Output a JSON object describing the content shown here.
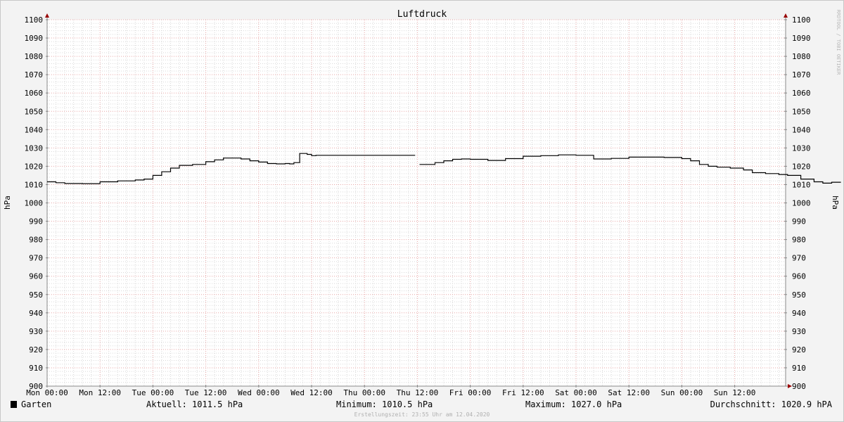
{
  "chart_data": {
    "type": "line",
    "title": "Luftdruck",
    "ylabel": "hPa",
    "ylim": [
      900,
      1100
    ],
    "y_ticks": [
      900,
      910,
      920,
      930,
      940,
      950,
      960,
      970,
      980,
      990,
      1000,
      1010,
      1020,
      1030,
      1040,
      1050,
      1060,
      1070,
      1080,
      1090,
      1100
    ],
    "x_tick_labels": [
      "Mon 00:00",
      "Mon 12:00",
      "Tue 00:00",
      "Tue 12:00",
      "Wed 00:00",
      "Wed 12:00",
      "Thu 00:00",
      "Thu 12:00",
      "Fri 00:00",
      "Fri 12:00",
      "Sat 00:00",
      "Sat 12:00",
      "Sun 00:00",
      "Sun 12:00"
    ],
    "x_unit": "hours since Mon 00:00",
    "xlim": [
      0,
      168
    ],
    "grid": true,
    "series": [
      {
        "name": "Garten",
        "color": "#000000",
        "segments": [
          [
            [
              0,
              1011.5
            ],
            [
              2,
              1011
            ],
            [
              4,
              1010.6
            ],
            [
              8,
              1010.5
            ],
            [
              12,
              1011.5
            ],
            [
              16,
              1012
            ],
            [
              20,
              1012.5
            ],
            [
              22,
              1013
            ],
            [
              24,
              1015
            ],
            [
              26,
              1017
            ],
            [
              28,
              1019
            ],
            [
              30,
              1020.5
            ],
            [
              33,
              1021
            ],
            [
              36,
              1022.5
            ],
            [
              38,
              1023.5
            ],
            [
              40,
              1024.5
            ],
            [
              42,
              1024.5
            ],
            [
              44,
              1024
            ],
            [
              46,
              1023
            ],
            [
              48,
              1022.3
            ],
            [
              50,
              1021.5
            ],
            [
              52,
              1021.3
            ],
            [
              54,
              1021.5
            ],
            [
              55,
              1021.3
            ],
            [
              56,
              1022
            ],
            [
              57,
              1022
            ],
            [
              57.3,
              1027
            ],
            [
              59,
              1026.5
            ],
            [
              60,
              1025.8
            ],
            [
              61,
              1026
            ],
            [
              64,
              1026
            ],
            [
              70,
              1026
            ],
            [
              76,
              1026
            ],
            [
              82,
              1026
            ],
            [
              83.5,
              1026
            ]
          ],
          [
            [
              84.5,
              1021
            ],
            [
              86,
              1021
            ],
            [
              88,
              1022
            ],
            [
              90,
              1023
            ],
            [
              92,
              1023.8
            ],
            [
              94,
              1024
            ],
            [
              96,
              1023.8
            ],
            [
              100,
              1023.2
            ],
            [
              104,
              1024.2
            ],
            [
              108,
              1025.5
            ],
            [
              112,
              1025.8
            ],
            [
              116,
              1026.2
            ],
            [
              120,
              1026
            ],
            [
              124,
              1024
            ],
            [
              128,
              1024.3
            ],
            [
              132,
              1025
            ],
            [
              136,
              1025
            ],
            [
              140,
              1024.8
            ],
            [
              144,
              1024.2
            ],
            [
              146,
              1023
            ],
            [
              148,
              1021
            ],
            [
              150,
              1020
            ],
            [
              152,
              1019.5
            ],
            [
              155,
              1019
            ],
            [
              158,
              1018
            ],
            [
              160,
              1016.5
            ],
            [
              163,
              1016
            ],
            [
              166,
              1015.5
            ],
            [
              168,
              1015
            ],
            [
              171,
              1013
            ],
            [
              174,
              1011.5
            ],
            [
              176,
              1010.8
            ],
            [
              178,
              1011.3
            ],
            [
              180,
              1011.5
            ]
          ]
        ]
      }
    ]
  },
  "legend": {
    "series_label": "Garten",
    "series_color": "#000000",
    "aktuell": "Aktuell: 1011.5 hPa",
    "minimum": "Minimum: 1010.5 hPa",
    "maximum": "Maximum: 1027.0 hPa",
    "durchschnitt": "Durchschnitt: 1020.9 hPA"
  },
  "footer": {
    "created": "Erstellungszeit: 23:55 Uhr am 12.04.2020"
  },
  "watermark": "RRDTOOL / TOBI OETIKER",
  "colors": {
    "background": "#f3f3f3",
    "plot_bg": "#ffffff",
    "major_grid": "#e7a6a6",
    "minor_grid": "#d9d9d9",
    "axis": "#888888",
    "arrow": "#990000"
  }
}
